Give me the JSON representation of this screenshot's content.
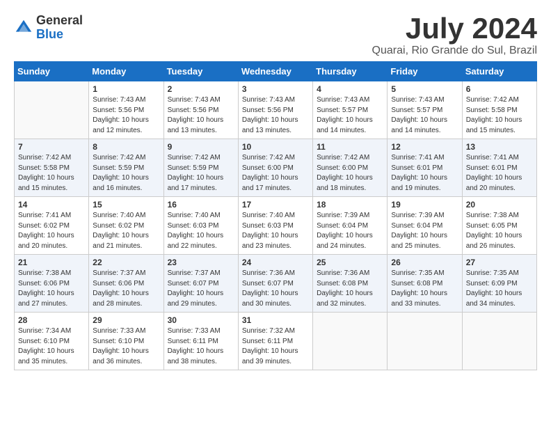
{
  "header": {
    "logo_general": "General",
    "logo_blue": "Blue",
    "month_title": "July 2024",
    "location": "Quarai, Rio Grande do Sul, Brazil"
  },
  "weekdays": [
    "Sunday",
    "Monday",
    "Tuesday",
    "Wednesday",
    "Thursday",
    "Friday",
    "Saturday"
  ],
  "weeks": [
    [
      {
        "day": "",
        "info": ""
      },
      {
        "day": "1",
        "info": "Sunrise: 7:43 AM\nSunset: 5:56 PM\nDaylight: 10 hours\nand 12 minutes."
      },
      {
        "day": "2",
        "info": "Sunrise: 7:43 AM\nSunset: 5:56 PM\nDaylight: 10 hours\nand 13 minutes."
      },
      {
        "day": "3",
        "info": "Sunrise: 7:43 AM\nSunset: 5:56 PM\nDaylight: 10 hours\nand 13 minutes."
      },
      {
        "day": "4",
        "info": "Sunrise: 7:43 AM\nSunset: 5:57 PM\nDaylight: 10 hours\nand 14 minutes."
      },
      {
        "day": "5",
        "info": "Sunrise: 7:43 AM\nSunset: 5:57 PM\nDaylight: 10 hours\nand 14 minutes."
      },
      {
        "day": "6",
        "info": "Sunrise: 7:42 AM\nSunset: 5:58 PM\nDaylight: 10 hours\nand 15 minutes."
      }
    ],
    [
      {
        "day": "7",
        "info": "Sunrise: 7:42 AM\nSunset: 5:58 PM\nDaylight: 10 hours\nand 15 minutes."
      },
      {
        "day": "8",
        "info": "Sunrise: 7:42 AM\nSunset: 5:59 PM\nDaylight: 10 hours\nand 16 minutes."
      },
      {
        "day": "9",
        "info": "Sunrise: 7:42 AM\nSunset: 5:59 PM\nDaylight: 10 hours\nand 17 minutes."
      },
      {
        "day": "10",
        "info": "Sunrise: 7:42 AM\nSunset: 6:00 PM\nDaylight: 10 hours\nand 17 minutes."
      },
      {
        "day": "11",
        "info": "Sunrise: 7:42 AM\nSunset: 6:00 PM\nDaylight: 10 hours\nand 18 minutes."
      },
      {
        "day": "12",
        "info": "Sunrise: 7:41 AM\nSunset: 6:01 PM\nDaylight: 10 hours\nand 19 minutes."
      },
      {
        "day": "13",
        "info": "Sunrise: 7:41 AM\nSunset: 6:01 PM\nDaylight: 10 hours\nand 20 minutes."
      }
    ],
    [
      {
        "day": "14",
        "info": "Sunrise: 7:41 AM\nSunset: 6:02 PM\nDaylight: 10 hours\nand 20 minutes."
      },
      {
        "day": "15",
        "info": "Sunrise: 7:40 AM\nSunset: 6:02 PM\nDaylight: 10 hours\nand 21 minutes."
      },
      {
        "day": "16",
        "info": "Sunrise: 7:40 AM\nSunset: 6:03 PM\nDaylight: 10 hours\nand 22 minutes."
      },
      {
        "day": "17",
        "info": "Sunrise: 7:40 AM\nSunset: 6:03 PM\nDaylight: 10 hours\nand 23 minutes."
      },
      {
        "day": "18",
        "info": "Sunrise: 7:39 AM\nSunset: 6:04 PM\nDaylight: 10 hours\nand 24 minutes."
      },
      {
        "day": "19",
        "info": "Sunrise: 7:39 AM\nSunset: 6:04 PM\nDaylight: 10 hours\nand 25 minutes."
      },
      {
        "day": "20",
        "info": "Sunrise: 7:38 AM\nSunset: 6:05 PM\nDaylight: 10 hours\nand 26 minutes."
      }
    ],
    [
      {
        "day": "21",
        "info": "Sunrise: 7:38 AM\nSunset: 6:06 PM\nDaylight: 10 hours\nand 27 minutes."
      },
      {
        "day": "22",
        "info": "Sunrise: 7:37 AM\nSunset: 6:06 PM\nDaylight: 10 hours\nand 28 minutes."
      },
      {
        "day": "23",
        "info": "Sunrise: 7:37 AM\nSunset: 6:07 PM\nDaylight: 10 hours\nand 29 minutes."
      },
      {
        "day": "24",
        "info": "Sunrise: 7:36 AM\nSunset: 6:07 PM\nDaylight: 10 hours\nand 30 minutes."
      },
      {
        "day": "25",
        "info": "Sunrise: 7:36 AM\nSunset: 6:08 PM\nDaylight: 10 hours\nand 32 minutes."
      },
      {
        "day": "26",
        "info": "Sunrise: 7:35 AM\nSunset: 6:08 PM\nDaylight: 10 hours\nand 33 minutes."
      },
      {
        "day": "27",
        "info": "Sunrise: 7:35 AM\nSunset: 6:09 PM\nDaylight: 10 hours\nand 34 minutes."
      }
    ],
    [
      {
        "day": "28",
        "info": "Sunrise: 7:34 AM\nSunset: 6:10 PM\nDaylight: 10 hours\nand 35 minutes."
      },
      {
        "day": "29",
        "info": "Sunrise: 7:33 AM\nSunset: 6:10 PM\nDaylight: 10 hours\nand 36 minutes."
      },
      {
        "day": "30",
        "info": "Sunrise: 7:33 AM\nSunset: 6:11 PM\nDaylight: 10 hours\nand 38 minutes."
      },
      {
        "day": "31",
        "info": "Sunrise: 7:32 AM\nSunset: 6:11 PM\nDaylight: 10 hours\nand 39 minutes."
      },
      {
        "day": "",
        "info": ""
      },
      {
        "day": "",
        "info": ""
      },
      {
        "day": "",
        "info": ""
      }
    ]
  ]
}
